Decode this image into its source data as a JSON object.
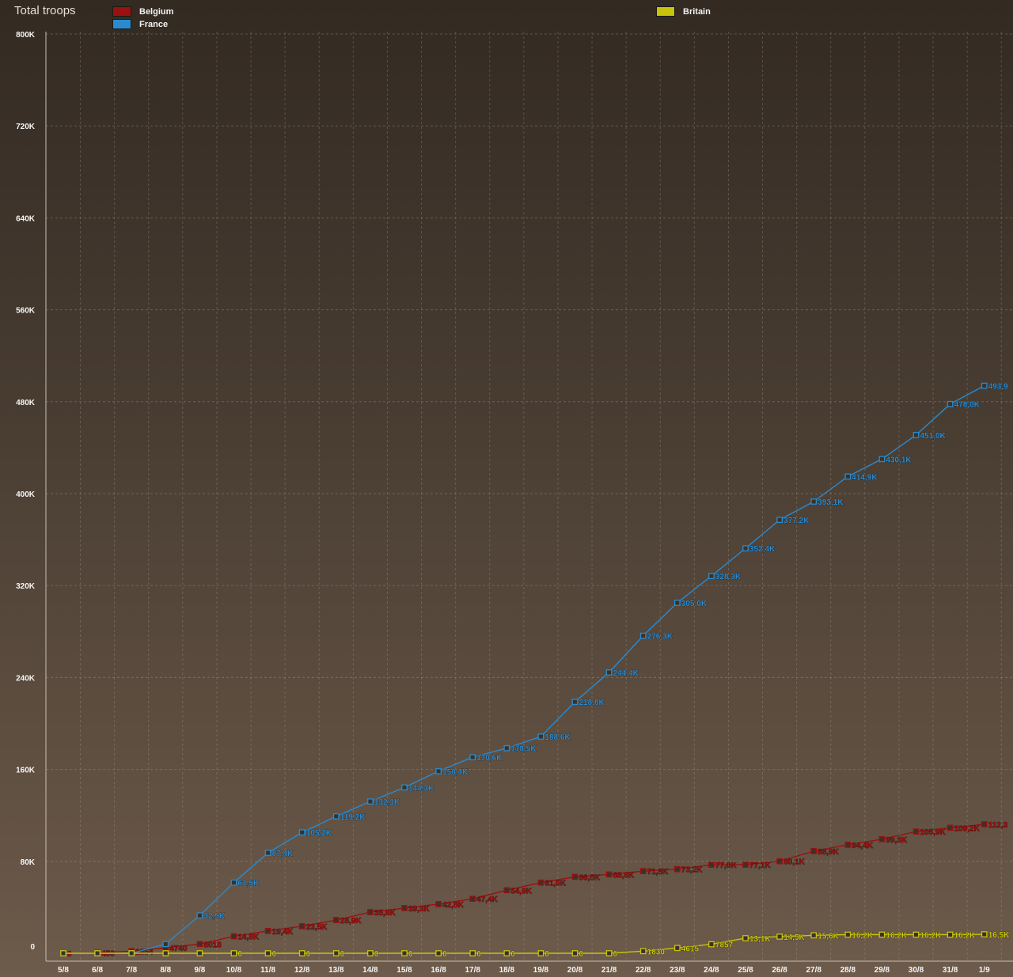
{
  "chart_data": {
    "type": "line",
    "title": "Total troops",
    "xlabel": "",
    "ylabel": "",
    "ylim": [
      0,
      800000
    ],
    "y_ticks": [
      {
        "value": 0,
        "label": "0"
      },
      {
        "value": 80000,
        "label": "80K"
      },
      {
        "value": 160000,
        "label": "160K"
      },
      {
        "value": 240000,
        "label": "240K"
      },
      {
        "value": 320000,
        "label": "320K"
      },
      {
        "value": 400000,
        "label": "400K"
      },
      {
        "value": 480000,
        "label": "480K"
      },
      {
        "value": 560000,
        "label": "560K"
      },
      {
        "value": 640000,
        "label": "640K"
      },
      {
        "value": 720000,
        "label": "720K"
      },
      {
        "value": 800000,
        "label": "800K"
      }
    ],
    "categories": [
      "5/8",
      "6/8",
      "7/8",
      "8/8",
      "9/8",
      "10/8",
      "11/8",
      "12/8",
      "13/8",
      "14/8",
      "15/8",
      "16/8",
      "17/8",
      "18/8",
      "19/8",
      "20/8",
      "21/8",
      "22/8",
      "23/8",
      "24/8",
      "25/8",
      "26/8",
      "27/8",
      "28/8",
      "29/8",
      "30/8",
      "31/8",
      "1/9"
    ],
    "grid": true,
    "legend_position": "top",
    "series": [
      {
        "name": "Belgium",
        "color": "#9b1010",
        "values": [
          0,
          450,
          1854,
          4740,
          8018,
          14800,
          19400,
          23500,
          28900,
          35800,
          39300,
          42800,
          47400,
          54900,
          61500,
          66500,
          68600,
          71500,
          73200,
          77000,
          77100,
          80100,
          88900,
          94400,
          99300,
          105900,
          109200,
          112300
        ],
        "labels": [
          "0",
          "450",
          "1854",
          "4740",
          "8018",
          "14,8K",
          "19,4K",
          "23,5K",
          "28,9K",
          "35,8K",
          "39,3K",
          "42,8K",
          "47,4K",
          "54,9K",
          "61,5K",
          "66,5K",
          "68,6K",
          "71,5K",
          "73,2K",
          "77,0K",
          "77,1K",
          "80,1K",
          "88,9K",
          "94,4K",
          "99,3K",
          "105,9K",
          "109,2K",
          "112,3"
        ]
      },
      {
        "name": "France",
        "color": "#2a8ad0",
        "values": [
          0,
          0,
          0,
          8000,
          32900,
          61500,
          87400,
          105200,
          119200,
          132100,
          144300,
          158400,
          170600,
          178500,
          188600,
          218800,
          244400,
          276300,
          305000,
          328300,
          352400,
          377200,
          393100,
          414900,
          430100,
          451000,
          478000,
          493900
        ],
        "labels": [
          "",
          "",
          "",
          "",
          "32,9K",
          "61,5K",
          "87,4K",
          "105,2K",
          "119,2K",
          "132,1K",
          "144,3K",
          "158,4K",
          "170,6K",
          "178,5K",
          "188,6K",
          "218,8K",
          "244,4K",
          "276,3K",
          "305,0K",
          "328,3K",
          "352,4K",
          "377,2K",
          "393,1K",
          "414,9K",
          "430,1K",
          "451,0K",
          "478,0K",
          "493,9"
        ]
      },
      {
        "name": "Britain",
        "color": "#c8c40c",
        "values": [
          0,
          0,
          0,
          0,
          0,
          0,
          0,
          0,
          0,
          0,
          0,
          0,
          0,
          0,
          0,
          0,
          0,
          1830,
          4615,
          7857,
          13100,
          14500,
          15600,
          16200,
          16200,
          16200,
          16200,
          16500
        ],
        "labels": [
          "",
          "",
          "",
          "",
          "",
          "0",
          "0",
          "0",
          "0",
          "0",
          "0",
          "0",
          "0",
          "0",
          "0",
          "0",
          "0",
          "1830",
          "4615",
          "7857",
          "13,1K",
          "14,5K",
          "15,6K",
          "16,2K",
          "16,2K",
          "16,2K",
          "16,2K",
          "16,5K"
        ]
      }
    ]
  }
}
